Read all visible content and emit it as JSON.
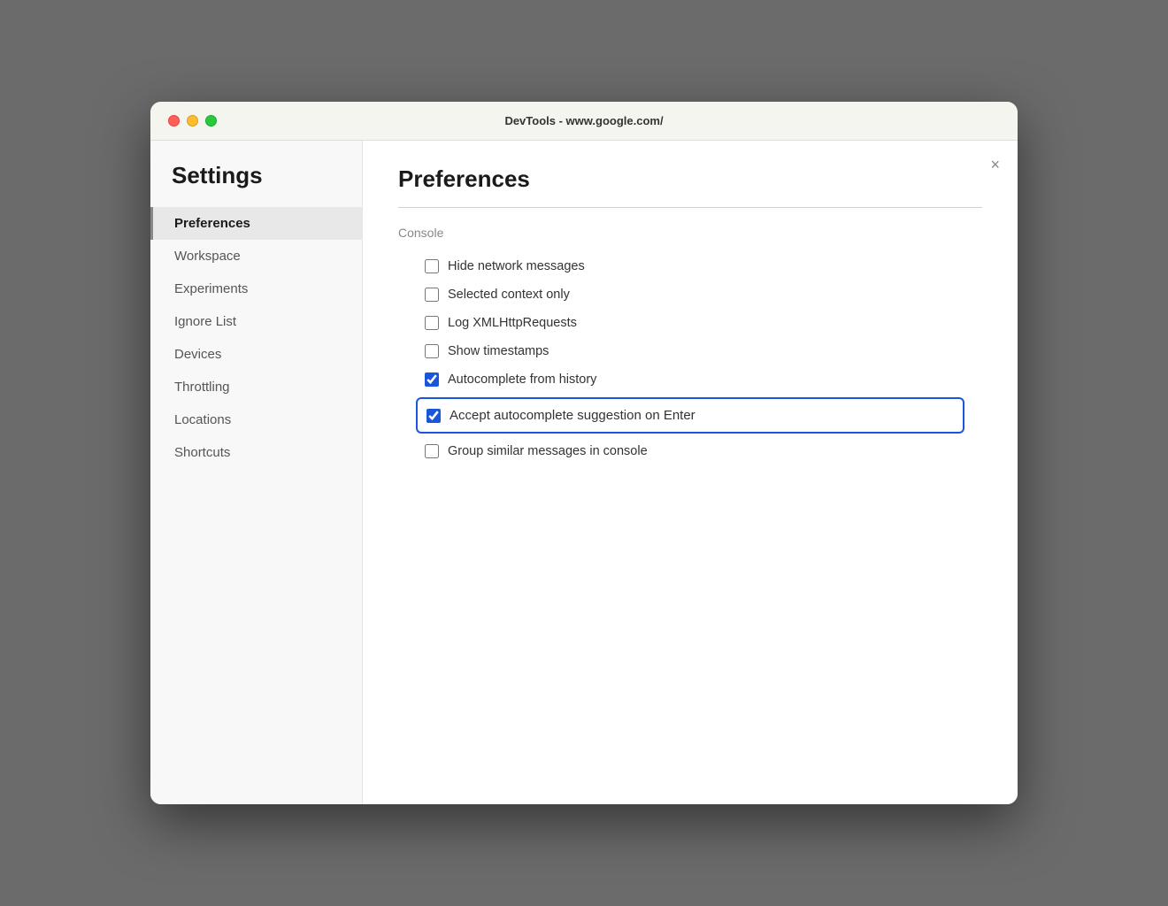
{
  "window": {
    "title": "DevTools - www.google.com/"
  },
  "sidebar": {
    "heading": "Settings",
    "items": [
      {
        "id": "preferences",
        "label": "Preferences",
        "active": true
      },
      {
        "id": "workspace",
        "label": "Workspace",
        "active": false
      },
      {
        "id": "experiments",
        "label": "Experiments",
        "active": false
      },
      {
        "id": "ignore-list",
        "label": "Ignore List",
        "active": false
      },
      {
        "id": "devices",
        "label": "Devices",
        "active": false
      },
      {
        "id": "throttling",
        "label": "Throttling",
        "active": false
      },
      {
        "id": "locations",
        "label": "Locations",
        "active": false
      },
      {
        "id": "shortcuts",
        "label": "Shortcuts",
        "active": false
      }
    ]
  },
  "content": {
    "title": "Preferences",
    "close_button": "×",
    "sections": [
      {
        "label": "Console",
        "checkboxes": [
          {
            "id": "hide-network",
            "label": "Hide network messages",
            "checked": false,
            "highlighted": false
          },
          {
            "id": "selected-context",
            "label": "Selected context only",
            "checked": false,
            "highlighted": false
          },
          {
            "id": "log-xmlhttp",
            "label": "Log XMLHttpRequests",
            "checked": false,
            "highlighted": false
          },
          {
            "id": "show-timestamps",
            "label": "Show timestamps",
            "checked": false,
            "highlighted": false
          },
          {
            "id": "autocomplete-history",
            "label": "Autocomplete from history",
            "checked": true,
            "highlighted": false
          },
          {
            "id": "accept-autocomplete",
            "label": "Accept autocomplete suggestion on Enter",
            "checked": true,
            "highlighted": true
          },
          {
            "id": "group-similar",
            "label": "Group similar messages in console",
            "checked": false,
            "highlighted": false
          }
        ]
      }
    ]
  },
  "traffic_lights": {
    "close": "close",
    "minimize": "minimize",
    "maximize": "maximize"
  }
}
